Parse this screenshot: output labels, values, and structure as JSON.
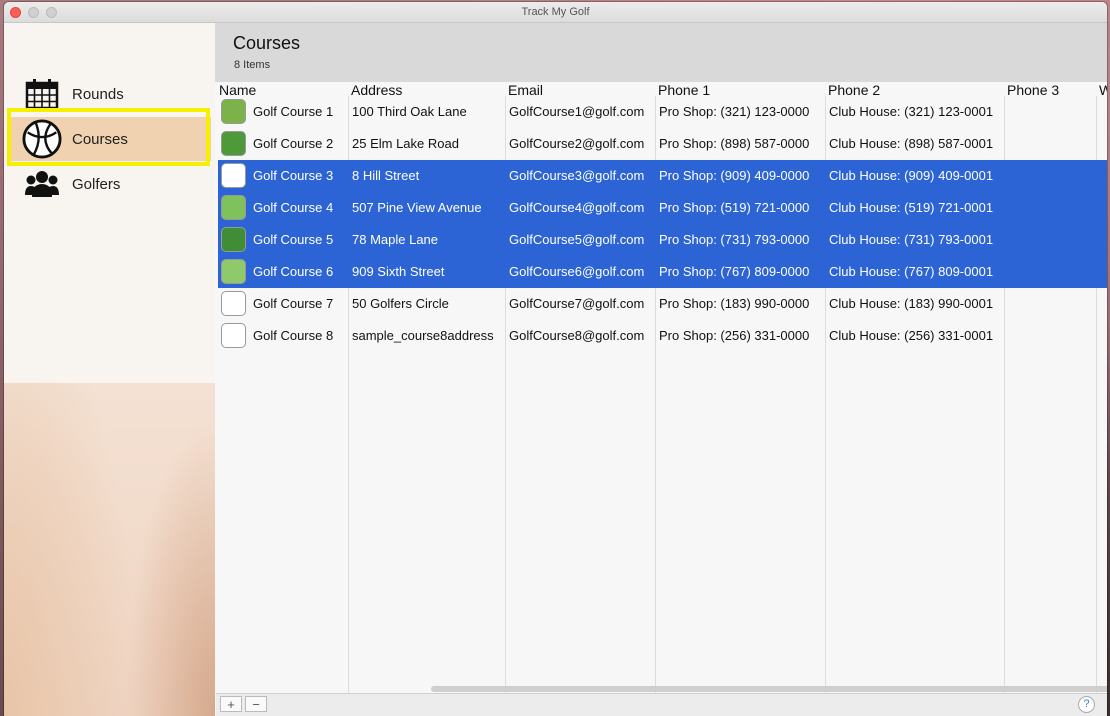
{
  "window": {
    "title": "Track My Golf"
  },
  "sidebar": {
    "items": [
      {
        "label": "Rounds",
        "icon": "calendar-icon"
      },
      {
        "label": "Courses",
        "icon": "golf-ball-icon"
      },
      {
        "label": "Golfers",
        "icon": "people-icon"
      }
    ],
    "selected_color": "#f0d1b0",
    "highlight_color": "#f6f000"
  },
  "header": {
    "title": "Courses",
    "subtitle": "8 Items"
  },
  "table": {
    "columns": [
      "Name",
      "Address",
      "Email",
      "Phone 1",
      "Phone 2",
      "Phone 3",
      "W"
    ],
    "rows": [
      {
        "name": "Golf Course 1",
        "address": "100 Third Oak Lane",
        "email": "GolfCourse1@golf.com",
        "phone1": "Pro Shop: (321) 123-0000",
        "phone2": "Club House: (321) 123-0001",
        "selected": false,
        "thumb": "#7bb34a"
      },
      {
        "name": "Golf Course 2",
        "address": "25 Elm Lake Road",
        "email": "GolfCourse2@golf.com",
        "phone1": "Pro Shop: (898) 587-0000",
        "phone2": "Club House: (898) 587-0001",
        "selected": false,
        "thumb": "#4e9a3a"
      },
      {
        "name": "Golf Course 3",
        "address": "8 Hill Street",
        "email": "GolfCourse3@golf.com",
        "phone1": "Pro Shop: (909) 409-0000",
        "phone2": "Club House: (909) 409-0001",
        "selected": true,
        "thumb": "#ffffff"
      },
      {
        "name": "Golf Course 4",
        "address": "507 Pine View Avenue",
        "email": "GolfCourse4@golf.com",
        "phone1": "Pro Shop: (519) 721-0000",
        "phone2": "Club House: (519) 721-0001",
        "selected": true,
        "thumb": "#7fc15a"
      },
      {
        "name": "Golf Course 5",
        "address": "78 Maple Lane",
        "email": "GolfCourse5@golf.com",
        "phone1": "Pro Shop: (731) 793-0000",
        "phone2": "Club House: (731) 793-0001",
        "selected": true,
        "thumb": "#3f8e35"
      },
      {
        "name": "Golf Course 6",
        "address": "909 Sixth Street",
        "email": "GolfCourse6@golf.com",
        "phone1": "Pro Shop: (767) 809-0000",
        "phone2": "Club House: (767) 809-0001",
        "selected": true,
        "thumb": "#8ec96a"
      },
      {
        "name": "Golf Course 7",
        "address": "50 Golfers Circle",
        "email": "GolfCourse7@golf.com",
        "phone1": "Pro Shop: (183) 990-0000",
        "phone2": "Club House: (183) 990-0001",
        "selected": false,
        "thumb": "#ffffff"
      },
      {
        "name": "Golf Course 8",
        "address": "sample_course8address",
        "email": "GolfCourse8@golf.com",
        "phone1": "Pro Shop: (256) 331-0000",
        "phone2": "Club House: (256) 331-0001",
        "selected": false,
        "thumb": "#ffffff"
      }
    ],
    "selection_color": "#2c64d6"
  },
  "footer": {
    "add_label": "+",
    "remove_label": "−",
    "help_label": "?"
  }
}
